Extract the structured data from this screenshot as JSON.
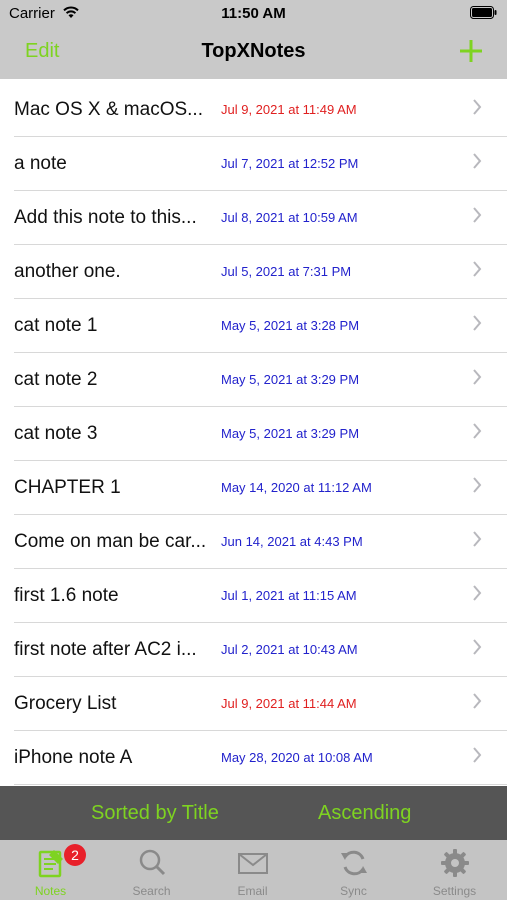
{
  "status_bar": {
    "carrier": "Carrier",
    "time": "11:50 AM"
  },
  "nav": {
    "edit_label": "Edit",
    "title": "TopXNotes",
    "add_icon": "plus-icon"
  },
  "colors": {
    "accent": "#7ed321",
    "recent_date": "#e02020",
    "date": "#2222cc",
    "badge": "#e8202a"
  },
  "notes": [
    {
      "title": "Mac OS X & macOS...",
      "date": "Jul 9, 2021 at 11:49 AM",
      "recent": true
    },
    {
      "title": "a note",
      "date": "Jul 7, 2021 at 12:52 PM",
      "recent": false
    },
    {
      "title": "Add this note to this...",
      "date": "Jul 8, 2021 at 10:59 AM",
      "recent": false
    },
    {
      "title": "another one.",
      "date": "Jul 5, 2021 at 7:31 PM",
      "recent": false
    },
    {
      "title": "cat note 1",
      "date": "May 5, 2021 at 3:28 PM",
      "recent": false
    },
    {
      "title": "cat note 2",
      "date": "May 5, 2021 at 3:29 PM",
      "recent": false
    },
    {
      "title": "cat note 3",
      "date": "May 5, 2021 at 3:29 PM",
      "recent": false
    },
    {
      "title": "CHAPTER 1",
      "date": "May 14, 2020 at 11:12 AM",
      "recent": false
    },
    {
      "title": "Come on man be car...",
      "date": "Jun 14, 2021 at 4:43 PM",
      "recent": false
    },
    {
      "title": "first 1.6 note",
      "date": "Jul 1, 2021 at 11:15 AM",
      "recent": false
    },
    {
      "title": "first note after AC2 i...",
      "date": "Jul 2, 2021 at 10:43 AM",
      "recent": false
    },
    {
      "title": "Grocery List",
      "date": "Jul 9, 2021 at 11:44 AM",
      "recent": true
    },
    {
      "title": "iPhone note A",
      "date": "May 28, 2020 at 10:08 AM",
      "recent": false
    }
  ],
  "sort_bar": {
    "sort_by": "Sorted by Title",
    "order": "Ascending"
  },
  "tabs": [
    {
      "label": "Notes",
      "icon": "notes-icon",
      "active": true,
      "badge": "2"
    },
    {
      "label": "Search",
      "icon": "search-icon",
      "active": false
    },
    {
      "label": "Email",
      "icon": "envelope-icon",
      "active": false
    },
    {
      "label": "Sync",
      "icon": "sync-icon",
      "active": false
    },
    {
      "label": "Settings",
      "icon": "gear-icon",
      "active": false
    }
  ]
}
